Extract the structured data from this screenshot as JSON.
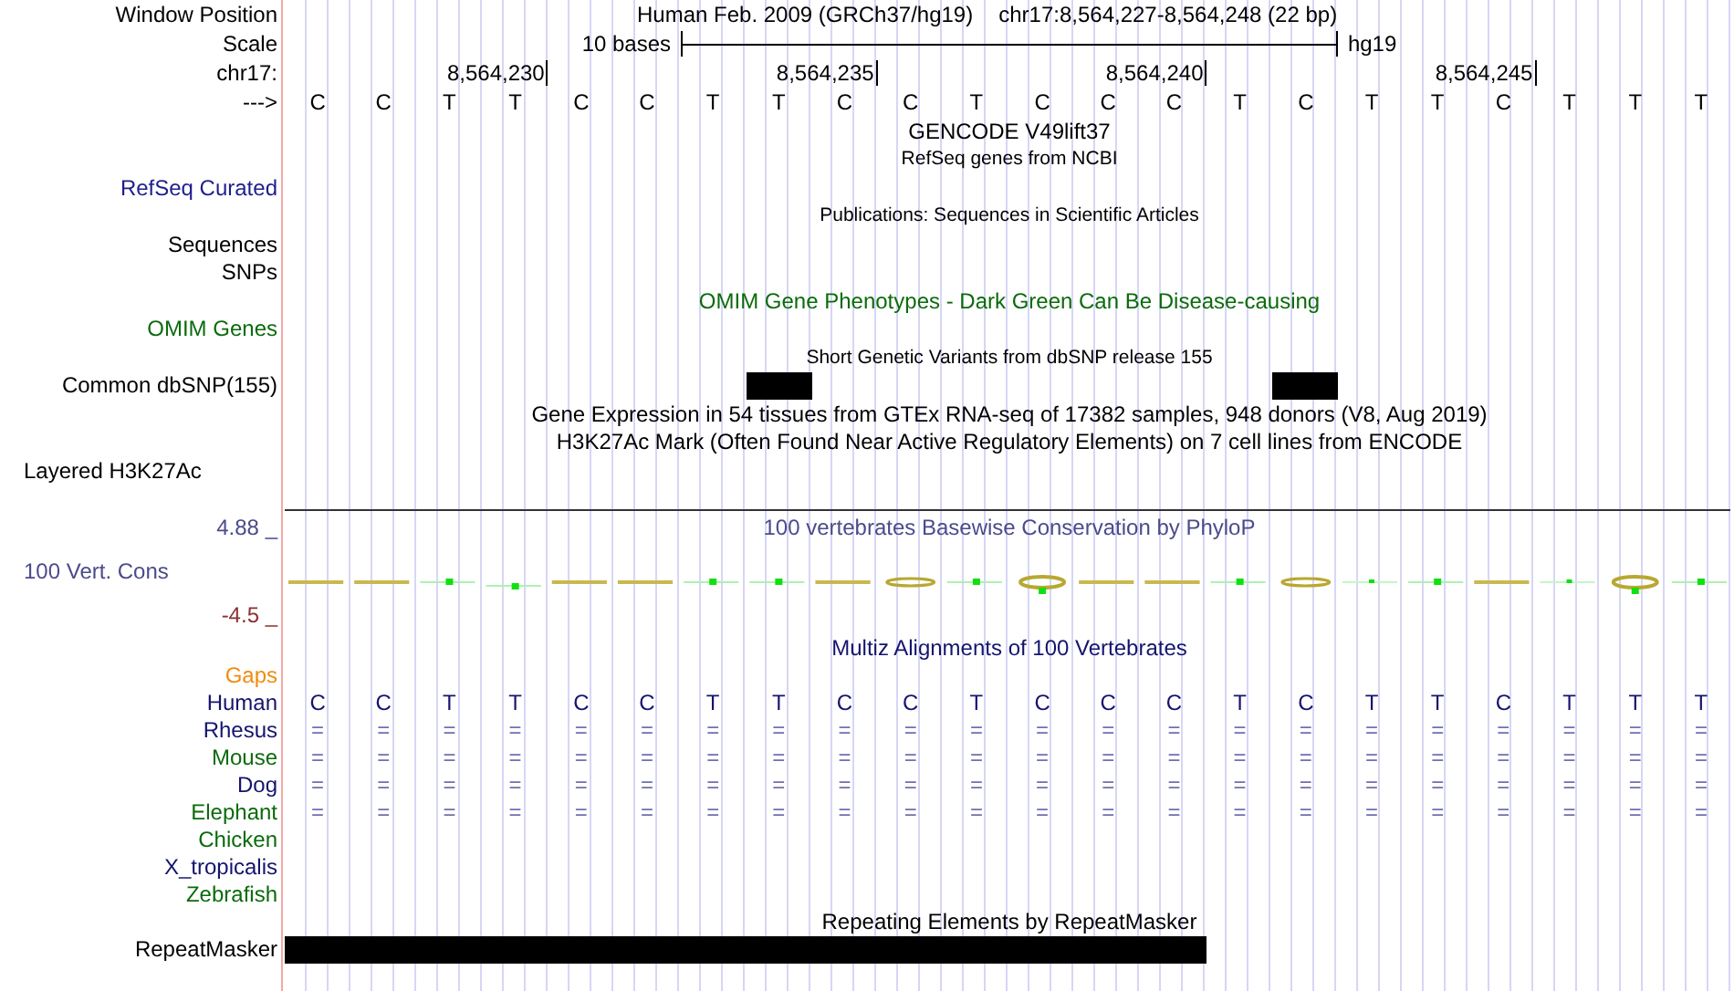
{
  "rows": [
    {
      "kind": "position",
      "label": "Window Position",
      "title": "Human Feb. 2009 (GRCh37/hg19)",
      "position": "chr17:8,564,227-8,564,248 (22 bp)",
      "color": "#000000"
    },
    {
      "kind": "scale",
      "label": "Scale",
      "title": "10 bases",
      "assembly": "hg19",
      "color": "#000000"
    },
    {
      "kind": "ruler",
      "label": "chr17:",
      "ticks": [
        "8,564,230",
        "8,564,235",
        "8,564,240",
        "8,564,245"
      ],
      "color": "#000000"
    },
    {
      "kind": "bases",
      "label": "--->",
      "bases": [
        "C",
        "C",
        "T",
        "T",
        "C",
        "C",
        "T",
        "T",
        "C",
        "C",
        "T",
        "C",
        "C",
        "C",
        "T",
        "C",
        "T",
        "T",
        "C",
        "T",
        "T",
        "T"
      ],
      "color": "#000000"
    },
    {
      "kind": "title",
      "title": "GENCODE V49lift37",
      "color": "#000000"
    },
    {
      "kind": "caption",
      "title": "RefSeq genes from NCBI",
      "color": "#000000"
    },
    {
      "kind": "label",
      "label": "RefSeq Curated",
      "color": "#1e1e8c"
    },
    {
      "kind": "caption",
      "title": "Publications: Sequences in Scientific Articles",
      "color": "#000000"
    },
    {
      "kind": "label",
      "label": "Sequences",
      "color": "#000000"
    },
    {
      "kind": "label",
      "label": "SNPs",
      "color": "#000000"
    },
    {
      "kind": "title",
      "title": "OMIM Gene Phenotypes - Dark Green Can Be Disease-causing",
      "color": "#0b6b0b"
    },
    {
      "kind": "label",
      "label": "OMIM Genes",
      "color": "#0b6b0b"
    },
    {
      "kind": "caption",
      "title": "Short Genetic Variants from dbSNP release 155",
      "color": "#000000"
    },
    {
      "kind": "snps",
      "label": "Common dbSNP(155)",
      "color": "#000000"
    },
    {
      "kind": "title",
      "title": "Gene Expression in 54 tissues from GTEx RNA-seq of 17382 samples, 948 donors (V8, Aug 2019)",
      "color": "#000000"
    },
    {
      "kind": "title",
      "title": "H3K27Ac Mark (Often Found Near Active Regulatory Elements) on 7 cell lines from ENCODE",
      "color": "#000000"
    },
    {
      "kind": "side_label",
      "label": "Layered H3K27Ac",
      "color": "#000000"
    },
    {
      "kind": "divider"
    },
    {
      "kind": "conservation",
      "title": "100 vertebrates Basewise Conservation by PhyloP",
      "label": "100 Vert. Cons",
      "max": "4.88 _",
      "min": "-4.5 _",
      "color": "#4b4b8c"
    },
    {
      "kind": "title",
      "title": "Multiz Alignments of 100 Vertebrates",
      "color": "#14146e"
    },
    {
      "kind": "label",
      "label": "Gaps",
      "color": "#f08c10"
    },
    {
      "kind": "bases",
      "label": "Human",
      "bases": [
        "C",
        "C",
        "T",
        "T",
        "C",
        "C",
        "T",
        "T",
        "C",
        "C",
        "T",
        "C",
        "C",
        "C",
        "T",
        "C",
        "T",
        "T",
        "C",
        "T",
        "T",
        "T"
      ],
      "color": "#14146e"
    },
    {
      "kind": "matches",
      "label": "Rhesus",
      "bases": [
        "=",
        "=",
        "=",
        "=",
        "=",
        "=",
        "=",
        "=",
        "=",
        "=",
        "=",
        "=",
        "=",
        "=",
        "=",
        "=",
        "=",
        "=",
        "=",
        "=",
        "=",
        "="
      ],
      "color": "#14146e"
    },
    {
      "kind": "matches",
      "label": "Mouse",
      "bases": [
        "=",
        "=",
        "=",
        "=",
        "=",
        "=",
        "=",
        "=",
        "=",
        "=",
        "=",
        "=",
        "=",
        "=",
        "=",
        "=",
        "=",
        "=",
        "=",
        "=",
        "=",
        "="
      ],
      "color": "#0b6b0b"
    },
    {
      "kind": "matches",
      "label": "Dog",
      "bases": [
        "=",
        "=",
        "=",
        "=",
        "=",
        "=",
        "=",
        "=",
        "=",
        "=",
        "=",
        "=",
        "=",
        "=",
        "=",
        "=",
        "=",
        "=",
        "=",
        "=",
        "=",
        "="
      ],
      "color": "#14146e"
    },
    {
      "kind": "matches",
      "label": "Elephant",
      "bases": [
        "=",
        "=",
        "=",
        "=",
        "=",
        "=",
        "=",
        "=",
        "=",
        "=",
        "=",
        "=",
        "=",
        "=",
        "=",
        "=",
        "=",
        "=",
        "=",
        "=",
        "=",
        "="
      ],
      "color": "#0b6b0b"
    },
    {
      "kind": "label",
      "label": "Chicken",
      "color": "#0b6b0b"
    },
    {
      "kind": "label",
      "label": "X_tropicalis",
      "color": "#14146e"
    },
    {
      "kind": "label",
      "label": "Zebrafish",
      "color": "#0b6b0b"
    },
    {
      "kind": "title",
      "title": "Repeating Elements by RepeatMasker",
      "color": "#000000"
    },
    {
      "kind": "repeats",
      "label": "RepeatMasker",
      "color": "#000000"
    }
  ]
}
